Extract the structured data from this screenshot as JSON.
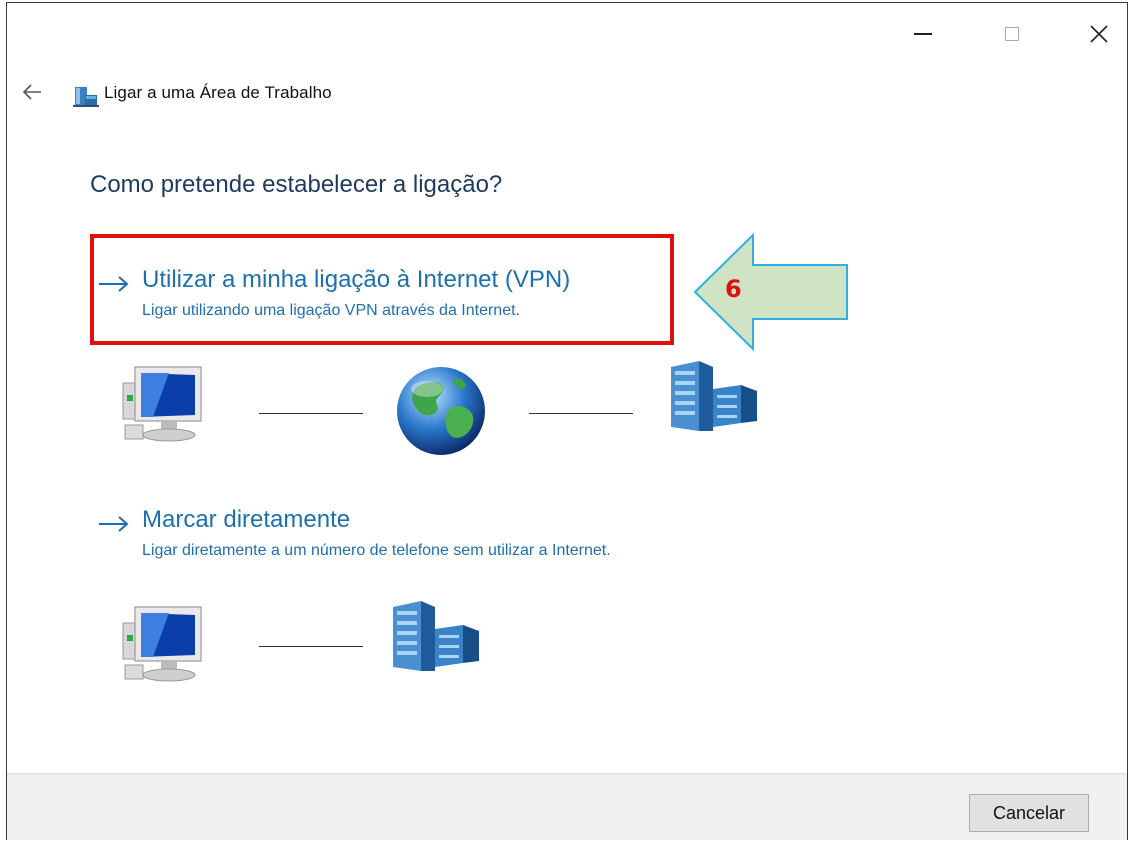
{
  "window": {
    "controls": {
      "minimize_icon": "minimize-icon",
      "maximize_icon": "maximize-icon",
      "close_icon": "close-icon"
    }
  },
  "header": {
    "back_icon": "back-arrow-icon",
    "app_icon": "workplace-network-icon",
    "title": "Ligar a uma Área de Trabalho"
  },
  "main": {
    "question": "Como pretende estabelecer a ligação?",
    "options": [
      {
        "title": "Utilizar a minha ligação à Internet (VPN)",
        "description": "Ligar utilizando uma ligação VPN através da Internet.",
        "diagram": [
          "computer-icon",
          "globe-icon",
          "office-building-icon"
        ]
      },
      {
        "title": "Marcar diretamente",
        "description": "Ligar diretamente a um número de telefone sem utilizar a Internet.",
        "diagram": [
          "computer-icon",
          "office-building-icon"
        ]
      }
    ]
  },
  "annotation": {
    "step_number": "6",
    "highlight_color": "#e01010",
    "arrow_fill": "#cfe4c4",
    "arrow_stroke": "#33b0e0"
  },
  "footer": {
    "cancel_label": "Cancelar"
  },
  "colors": {
    "link_blue": "#1e6fb0",
    "heading": "#1e3a5f",
    "footer_bg": "#f0f0f0"
  }
}
